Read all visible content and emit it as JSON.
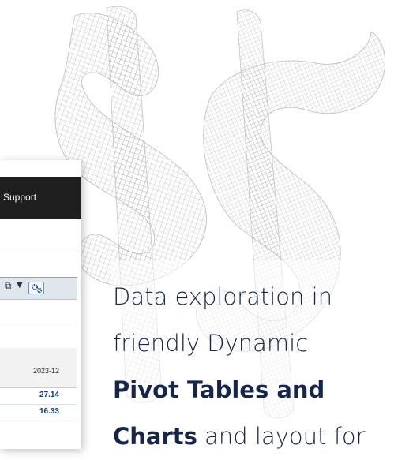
{
  "app": {
    "nav_support": "Support",
    "toolbar": {
      "expand_icon": "external-link-icon",
      "dropdown_icon": "caret-down-icon",
      "settings_icon": "gears-icon"
    },
    "pivot": {
      "column_header": "2023-12",
      "values": [
        "27.14",
        "16.33"
      ]
    }
  },
  "promo": {
    "line1": "Data exploration in",
    "line2": "friendly Dynamic",
    "line3_bold": "Pivot Tables and",
    "line4_bold": "Charts",
    "line4_rest": " and layout for"
  },
  "colors": {
    "text_dark": "#16254a",
    "value_blue": "#123b73",
    "header_dark": "#1f1f1f"
  }
}
